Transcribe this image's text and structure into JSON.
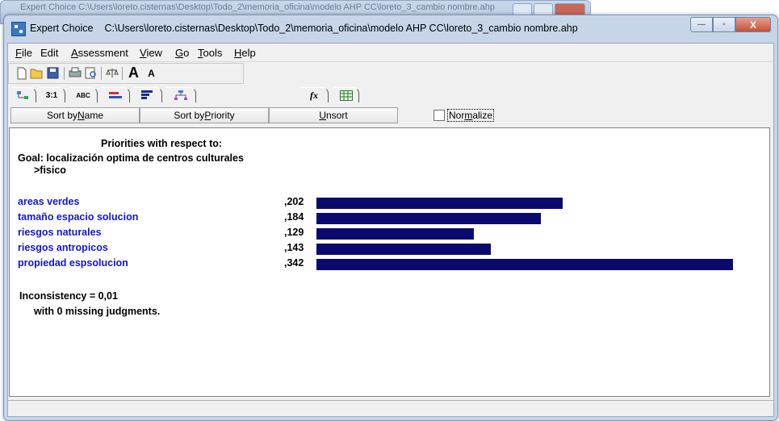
{
  "background_window": {
    "title": "Expert Choice     C:\\Users\\loreto.cisternas\\Desktop\\Todo_2\\memoria_oficina\\modelo AHP CC\\loreto_3_cambio nombre.ahp"
  },
  "window": {
    "app_name": "Expert Choice",
    "file_path": "C:\\Users\\loreto.cisternas\\Desktop\\Todo_2\\memoria_oficina\\modelo AHP CC\\loreto_3_cambio nombre.ahp",
    "minimize_glyph": "—",
    "maximize_glyph": "▫",
    "close_glyph": "X"
  },
  "menu": [
    {
      "pre": "",
      "key": "F",
      "post": "ile"
    },
    {
      "pre": "",
      "key": "",
      "post": "Edit"
    },
    {
      "pre": "",
      "key": "A",
      "post": "ssessment"
    },
    {
      "pre": "",
      "key": "V",
      "post": "iew"
    },
    {
      "pre": "",
      "key": "G",
      "post": "o"
    },
    {
      "pre": "",
      "key": "T",
      "post": "ools"
    },
    {
      "pre": "",
      "key": "H",
      "post": "elp"
    }
  ],
  "toolbar": {
    "icons": [
      "new-file-icon",
      "open-folder-icon",
      "save-icon",
      "print-icon",
      "print-preview-icon",
      "balance-icon",
      "increase-font-icon",
      "decrease-font-icon"
    ],
    "font_up_label": "A",
    "font_down_label": "A"
  },
  "tabs": [
    {
      "label": "",
      "icon": "tree-icon"
    },
    {
      "label": "3:1",
      "icon": ""
    },
    {
      "label": "ABC",
      "icon": ""
    },
    {
      "label": "",
      "icon": "bars-red-icon"
    },
    {
      "label": "",
      "icon": "bars-blue-icon"
    },
    {
      "label": "",
      "icon": "hierarchy-icon"
    },
    {
      "label": "fx",
      "icon": "formula-icon"
    },
    {
      "label": "",
      "icon": "grid-icon"
    }
  ],
  "sort": {
    "by_name_pre": "Sort by ",
    "by_name_key": "N",
    "by_name_post": "ame",
    "by_priority_pre": "Sort by ",
    "by_priority_key": "P",
    "by_priority_post": "riority",
    "unsort_key": "U",
    "unsort_post": "nsort",
    "normalize_pre": "Nor",
    "normalize_key": "m",
    "normalize_post": "alize",
    "normalize_checked": false
  },
  "priorities": {
    "heading": "Priorities with respect to:",
    "goal": "Goal: localización optima de centros culturales",
    "node": ">fisico",
    "items": [
      {
        "name": "areas verdes",
        "value": ",202",
        "priority": 0.202
      },
      {
        "name": "tamaño espacio solucion",
        "value": ",184",
        "priority": 0.184
      },
      {
        "name": "riesgos naturales",
        "value": ",129",
        "priority": 0.129
      },
      {
        "name": "riesgos antropicos",
        "value": ",143",
        "priority": 0.143
      },
      {
        "name": "propiedad espsolucion",
        "value": ",342",
        "priority": 0.342
      }
    ],
    "inconsistency": "Inconsistency = 0,01",
    "missing": "with 0  missing judgments."
  },
  "colors": {
    "bar": "#0a0a6e",
    "item_text": "#1414d8"
  }
}
